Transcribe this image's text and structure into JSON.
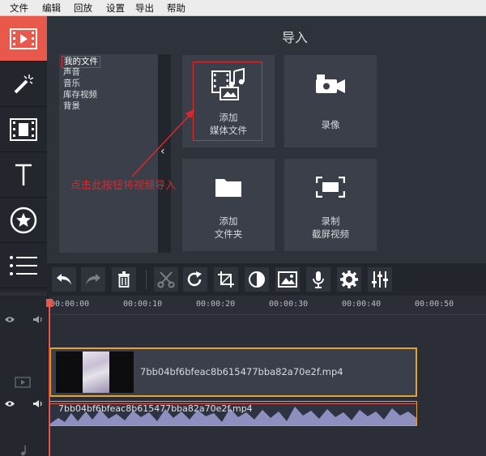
{
  "menu": [
    "文件",
    "编辑",
    "回放",
    "设置",
    "导出",
    "帮助"
  ],
  "sidebar": [
    {
      "name": "import-media-icon",
      "active": true
    },
    {
      "name": "magic-wand-icon",
      "active": false
    },
    {
      "name": "filmstrip-icon",
      "active": false
    },
    {
      "name": "text-icon",
      "active": false
    },
    {
      "name": "sticker-star-icon",
      "active": false
    },
    {
      "name": "list-icon",
      "active": false
    }
  ],
  "panel": {
    "title": "导入",
    "categories": [
      "我的文件",
      "声音",
      "音乐",
      "库存视频",
      "背景"
    ],
    "collapse_glyph": "‹",
    "tiles": [
      {
        "label": "添加\n媒体文件",
        "icon": "media-file-icon"
      },
      {
        "label": "录像",
        "icon": "camera-icon"
      },
      {
        "label": "添加\n文件夹",
        "icon": "folder-icon"
      },
      {
        "label": "录制\n截屏视频",
        "icon": "screen-record-icon"
      }
    ]
  },
  "annotation": "点击此按钮将视频导入",
  "toolbar": [
    "undo-icon",
    "redo-icon",
    "delete-icon",
    "cut-icon",
    "rotate-icon",
    "crop-icon",
    "color-adjust-icon",
    "image-icon",
    "microphone-icon",
    "settings-icon",
    "equalizer-icon"
  ],
  "timeline": {
    "ticks": [
      "00:00:00",
      "00:00:10",
      "00:00:20",
      "00:00:30",
      "00:00:40",
      "00:00:50"
    ],
    "video_clip_name": "7bb04bf6bfeac8b615477bba82a70e2f.mp4",
    "audio_clip_name": "7bb04bf6bfeac8b615477bba82a70e2f.mp4"
  }
}
